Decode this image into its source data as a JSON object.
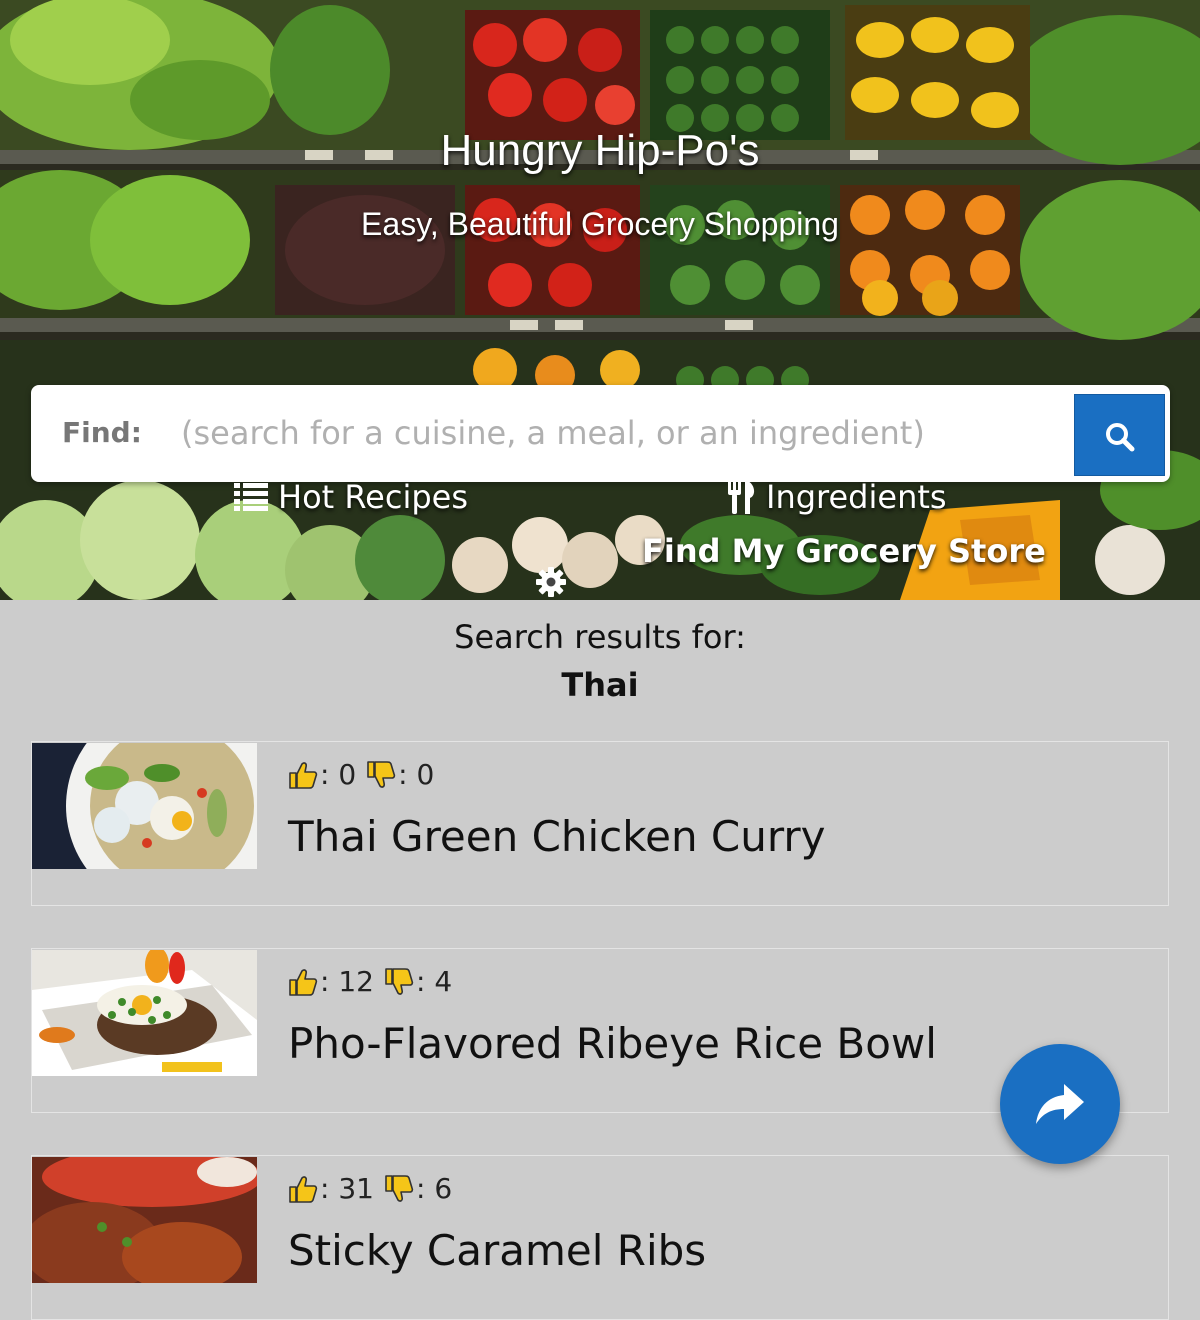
{
  "hero": {
    "title": "Hungry Hip-Po's",
    "subtitle": "Easy, Beautiful Grocery Shopping"
  },
  "search": {
    "label": "Find:",
    "value": "",
    "placeholder": "(search for a cuisine, a meal, or an ingredient)",
    "button_icon": "search-icon"
  },
  "nav": {
    "hot_recipes": "Hot Recipes",
    "hot_recipes_icon": "list-icon",
    "ingredients": "Ingredients",
    "ingredients_icon": "utensils-icon",
    "store": "Find My Grocery Store",
    "settings_icon": "gear-icon"
  },
  "results": {
    "label": "Search results for:",
    "query": "Thai",
    "items": [
      {
        "title": "Thai Green Chicken Curry",
        "likes": "0",
        "dislikes": "0"
      },
      {
        "title": "Pho-Flavored Ribeye Rice Bowl",
        "likes": "12",
        "dislikes": "4"
      },
      {
        "title": "Sticky Caramel Ribs",
        "likes": "31",
        "dislikes": "6"
      }
    ]
  },
  "fab": {
    "icon": "share-icon"
  },
  "colors": {
    "accent": "#1a6fc2",
    "background": "#cccccc",
    "thumb_icon": "#f5c518"
  }
}
